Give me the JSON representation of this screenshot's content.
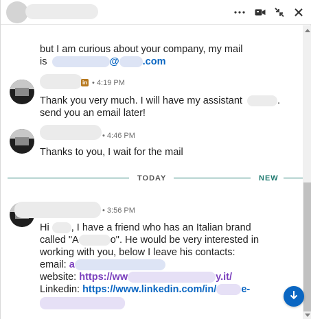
{
  "header": {
    "more_icon": "more-horizontal-icon",
    "video_icon": "video-camera-icon",
    "minimize_icon": "collapse-arrows-icon",
    "close_icon": "close-x-icon"
  },
  "messages": [
    {
      "lines": [
        "but I am curious about your company, my mail",
        "is"
      ],
      "email_at": "@",
      "email_tld": ".com"
    },
    {
      "time": "• 4:19 PM",
      "badge": "in",
      "lines": [
        "Thank you very much. I will have my assistant",
        "send you an email later!"
      ],
      "line1_tail": "."
    },
    {
      "time": "• 4:46 PM",
      "lines": [
        "Thanks to you, I wait for the mail"
      ]
    },
    {
      "time": "• 3:56 PM",
      "hi": "Hi",
      "hi_rest": ", I have a friend who has an Italian brand",
      "called_a": "called \"A",
      "called_b": "o\". He would be very interested in",
      "line3": "working with you, below I leave his contacts:",
      "email_label": "email:",
      "email_start": "a",
      "website_label": "website:",
      "website_start": "https://ww",
      "website_end": "y.it/",
      "linkedin_label": "Linkedin:",
      "linkedin_start": "https://www.linkedin.com/in/",
      "linkedin_end": "e-"
    }
  ],
  "divider": {
    "today": "TODAY",
    "new": "NEW"
  },
  "colors": {
    "accent": "#0a66c2",
    "divider": "#1f7a70",
    "link_purple": "#7a3fbd"
  },
  "jump_icon": "arrow-down-icon"
}
